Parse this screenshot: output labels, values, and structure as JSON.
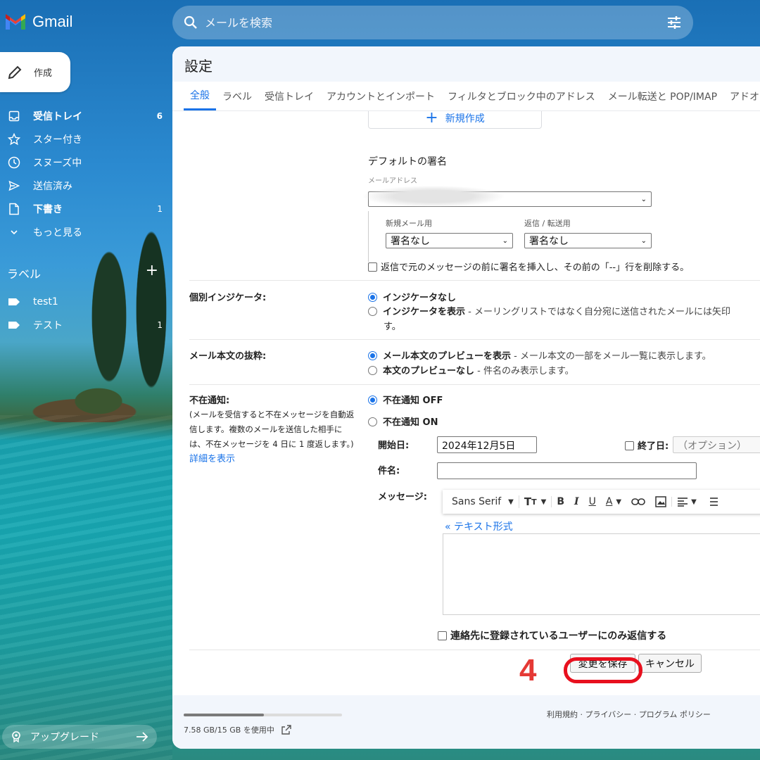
{
  "app": {
    "name": "Gmail"
  },
  "search": {
    "placeholder": "メールを検索"
  },
  "compose": {
    "label": "作成"
  },
  "nav": [
    {
      "label": "受信トレイ",
      "count": "6",
      "bold": true,
      "icon": "inbox-icon"
    },
    {
      "label": "スター付き",
      "count": "",
      "bold": false,
      "icon": "star-icon"
    },
    {
      "label": "スヌーズ中",
      "count": "",
      "bold": false,
      "icon": "clock-icon"
    },
    {
      "label": "送信済み",
      "count": "",
      "bold": false,
      "icon": "send-icon"
    },
    {
      "label": "下書き",
      "count": "1",
      "bold": true,
      "icon": "draft-icon"
    },
    {
      "label": "もっと見る",
      "count": "",
      "bold": false,
      "icon": "chevron-down-icon"
    }
  ],
  "labels": {
    "heading": "ラベル",
    "add": "+",
    "items": [
      {
        "label": "test1",
        "count": ""
      },
      {
        "label": "テスト",
        "count": "1"
      }
    ]
  },
  "upgrade": {
    "label": "アップグレード"
  },
  "settings": {
    "title": "設定",
    "tabs": [
      "全般",
      "ラベル",
      "受信トレイ",
      "アカウントとインポート",
      "フィルタとブロック中のアドレス",
      "メール転送と POP/IMAP",
      "アドオ"
    ],
    "signature": {
      "new_button": "新規作成",
      "default_heading": "デフォルトの署名",
      "email_label": "メールアドレス",
      "new_mail_label": "新規メール用",
      "reply_label": "返信 / 転送用",
      "new_mail_value": "署名なし",
      "reply_value": "署名なし",
      "insert_checkbox": "返信で元のメッセージの前に署名を挿入し、その前の「--」行を削除する。"
    },
    "indicator": {
      "label": "個別インジケータ:",
      "opt1": "インジケータなし",
      "opt2_bold": "インジケータを表示",
      "opt2_desc": " - メーリングリストではなく自分宛に送信されたメールには矢印",
      "opt2_cont": "す。"
    },
    "snippet": {
      "label": "メール本文の抜粋:",
      "opt1_bold": "メール本文のプレビューを表示",
      "opt1_desc": " - メール本文の一部をメール一覧に表示します。",
      "opt2_bold": "本文のプレビューなし",
      "opt2_desc": " - 件名のみ表示します。"
    },
    "vacation": {
      "label": "不在通知:",
      "desc1": "(メールを受信すると不在メッセージを自動返",
      "desc2": "信します。複数のメールを送信した相手に",
      "desc3": "は、不在メッセージを 4 日に 1 度返します。)",
      "learn_more": "詳細を表示",
      "off": "不在通知 OFF",
      "on": "不在通知 ON",
      "start_label": "開始日:",
      "start_value": "2024年12月5日",
      "end_label": "終了日:",
      "end_placeholder": "（オプション）",
      "subject_label": "件名:",
      "message_label": "メッセージ:",
      "font": "Sans Serif",
      "plain_text_link": "« テキスト形式",
      "contacts_only": "連絡先に登録されているユーザーにのみ返信する"
    },
    "save_button": "変更を保存",
    "cancel_button": "キャンセル"
  },
  "footer": {
    "storage": "7.58 GB/15 GB を使用中",
    "storage_fraction": 0.505,
    "links": "利用規約 · プライバシー · プログラム ポリシー"
  },
  "annotation": {
    "step": "4",
    "color": "#e53935"
  }
}
